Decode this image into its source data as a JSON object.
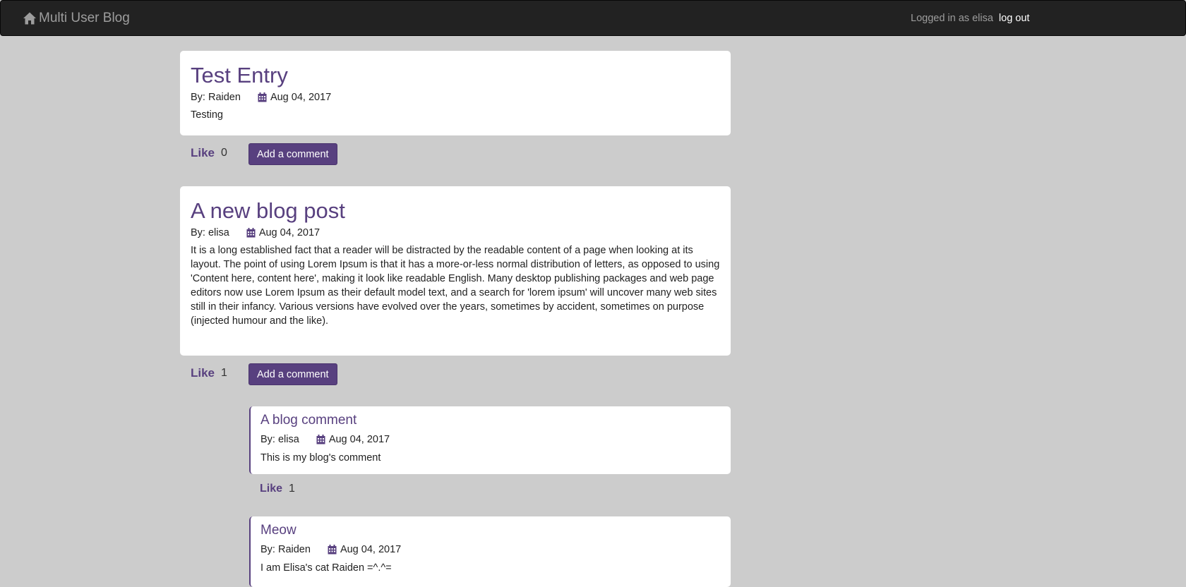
{
  "nav": {
    "brand": "Multi User Blog",
    "logged_in_text": "Logged in as elisa",
    "logout_label": "log out"
  },
  "posts": [
    {
      "title": "Test Entry",
      "author": "By: Raiden",
      "date": "Aug 04, 2017",
      "content": "Testing",
      "like_label": "Like",
      "like_count": "0",
      "comment_button": "Add a comment"
    },
    {
      "title": "A new blog post",
      "author": "By: elisa",
      "date": "Aug 04, 2017",
      "content": "It is a long established fact that a reader will be distracted by the readable content of a page when looking at its layout. The point of using Lorem Ipsum is that it has a more-or-less normal distribution of letters, as opposed to using 'Content here, content here', making it look like readable English. Many desktop publishing packages and web page editors now use Lorem Ipsum as their default model text, and a search for 'lorem ipsum' will uncover many web sites still in their infancy. Various versions have evolved over the years, sometimes by accident, sometimes on purpose (injected humour and the like).",
      "like_label": "Like",
      "like_count": "1",
      "comment_button": "Add a comment",
      "comments": [
        {
          "title": "A blog comment",
          "author": "By: elisa",
          "date": "Aug 04, 2017",
          "content": "This is my blog's comment",
          "like_label": "Like",
          "like_count": "1"
        },
        {
          "title": "Meow",
          "author": "By: Raiden",
          "date": "Aug 04, 2017",
          "content": "I am Elisa's cat Raiden =^.^="
        }
      ]
    }
  ],
  "colors": {
    "accent": "#58407f",
    "navbar": "#222222",
    "background": "#cccccc"
  }
}
